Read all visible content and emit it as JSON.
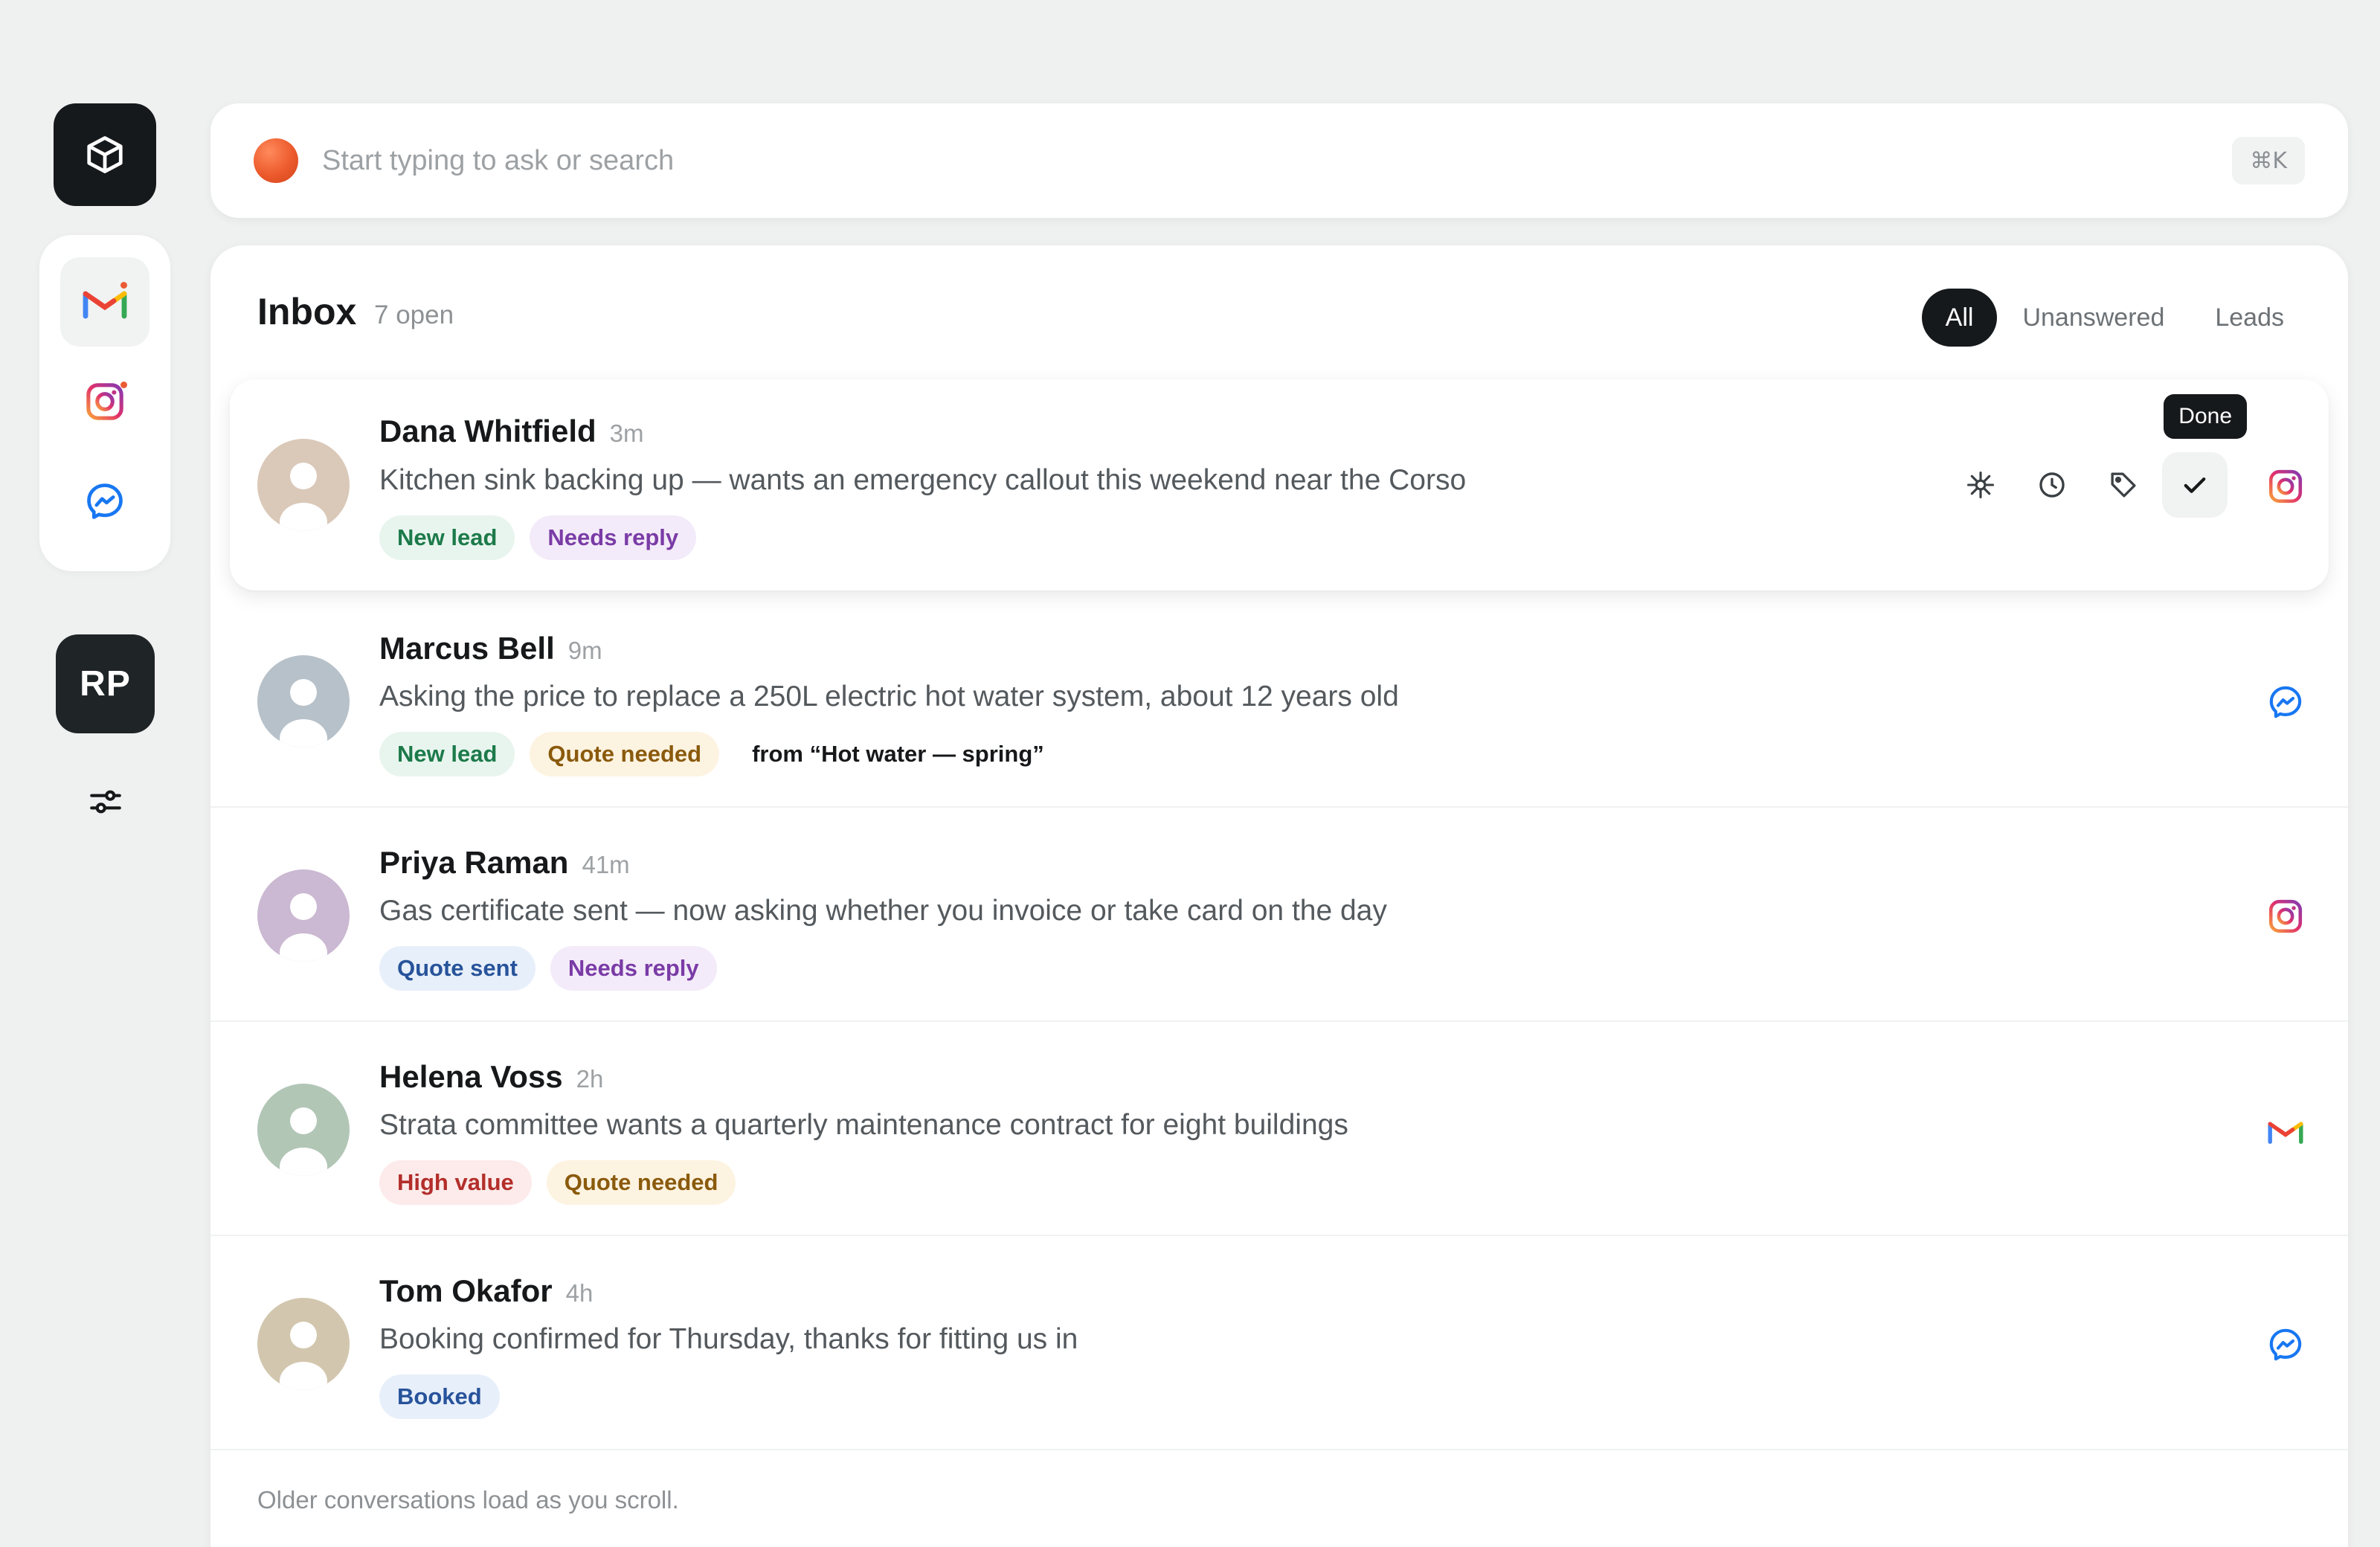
{
  "sidebar": {
    "logo_icon": "cube-icon",
    "apps": [
      {
        "name": "Gmail",
        "icon": "gmail-icon",
        "unread": true,
        "active": true
      },
      {
        "name": "Instagram",
        "icon": "instagram-icon",
        "unread": true,
        "active": false
      },
      {
        "name": "Messenger",
        "icon": "messenger-icon",
        "unread": false,
        "active": false
      }
    ],
    "user_initials": "RP",
    "settings_icon": "sliders-icon"
  },
  "search": {
    "placeholder": "Start typing to ask or search",
    "shortcut": "⌘K"
  },
  "inbox": {
    "title": "Inbox",
    "count_label": "7 open",
    "filters": [
      {
        "label": "All",
        "active": true
      },
      {
        "label": "Unanswered",
        "active": false
      },
      {
        "label": "Leads",
        "active": false
      }
    ],
    "conversations": [
      {
        "name": "Dana Whitfield",
        "time": "3m",
        "snippet": "Kitchen sink backing up — wants an emergency callout this weekend near the Corso",
        "tags": [
          {
            "label": "New lead",
            "color": "green"
          },
          {
            "label": "Needs reply",
            "color": "purple"
          }
        ],
        "source_note": "",
        "channel": "instagram-icon",
        "avatar_color": "#dac8b8"
      },
      {
        "name": "Marcus Bell",
        "time": "9m",
        "snippet": "Asking the price to replace a 250L electric hot water system, about 12 years old",
        "tags": [
          {
            "label": "New lead",
            "color": "green"
          },
          {
            "label": "Quote needed",
            "color": "amber"
          }
        ],
        "source_note": "from “Hot water — spring”",
        "channel": "messenger-icon",
        "avatar_color": "#b7c1c9"
      },
      {
        "name": "Priya Raman",
        "time": "41m",
        "snippet": "Gas certificate sent — now asking whether you invoice or take card on the day",
        "tags": [
          {
            "label": "Quote sent",
            "color": "blue"
          },
          {
            "label": "Needs reply",
            "color": "purple"
          }
        ],
        "source_note": "",
        "channel": "instagram-icon",
        "avatar_color": "#cbb8d2"
      },
      {
        "name": "Helena Voss",
        "time": "2h",
        "snippet": "Strata committee wants a quarterly maintenance contract for eight buildings",
        "tags": [
          {
            "label": "High value",
            "color": "red"
          },
          {
            "label": "Quote needed",
            "color": "amber"
          }
        ],
        "source_note": "",
        "channel": "gmail-icon",
        "avatar_color": "#b2c6b6"
      },
      {
        "name": "Tom Okafor",
        "time": "4h",
        "snippet": "Booking confirmed for Thursday, thanks for fitting us in",
        "tags": [
          {
            "label": "Booked",
            "color": "blue"
          }
        ],
        "source_note": "",
        "channel": "messenger-icon",
        "avatar_color": "#d2c6ae"
      }
    ],
    "row_actions": {
      "icons": [
        "snooze-star-icon",
        "clock-icon",
        "tag-icon",
        "check-icon"
      ],
      "tooltip": "Done"
    },
    "footer": "Older conversations load as you scroll."
  },
  "colors": {
    "background": "#eff0f0",
    "accent_dark": "#16191c",
    "search_orb": "#ec5a2c"
  }
}
